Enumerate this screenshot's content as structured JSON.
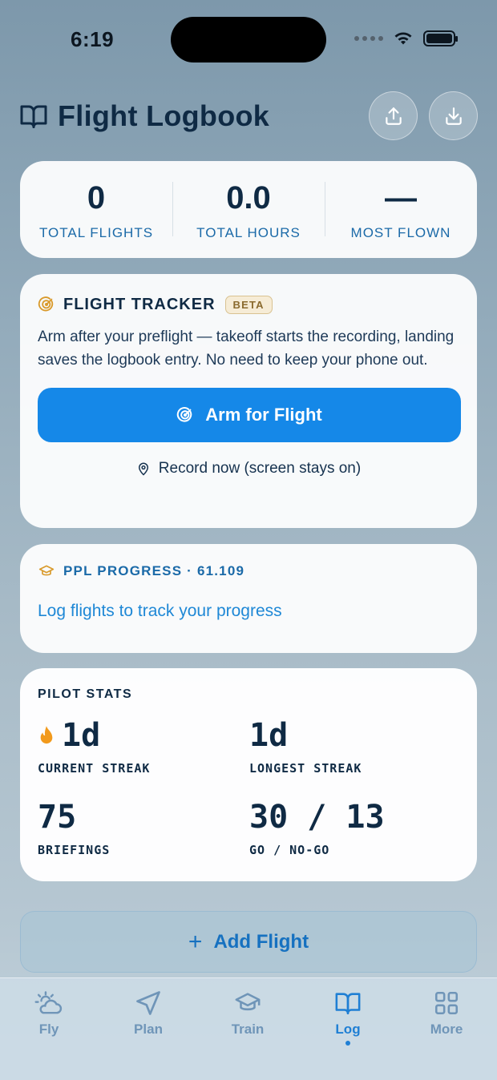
{
  "status_bar": {
    "time": "6:19"
  },
  "header": {
    "title": "Flight Logbook",
    "share_icon": "share-icon",
    "download_icon": "download-icon"
  },
  "summary": [
    {
      "value": "0",
      "label": "TOTAL FLIGHTS"
    },
    {
      "value": "0.0",
      "label": "TOTAL HOURS"
    },
    {
      "value": "—",
      "label": "MOST FLOWN"
    }
  ],
  "tracker": {
    "title": "FLIGHT TRACKER",
    "badge": "BETA",
    "description": "Arm after your preflight — takeoff starts the recording, landing saves the logbook entry. No need to keep your phone out.",
    "arm_label": "Arm for Flight",
    "record_label": "Record now (screen stays on)"
  },
  "ppl": {
    "title": "PPL PROGRESS · 61.109",
    "message": "Log flights to track your progress"
  },
  "stats": {
    "title": "PILOT STATS",
    "items": [
      {
        "value": "1d",
        "label": "CURRENT STREAK"
      },
      {
        "value": "1d",
        "label": "LONGEST STREAK"
      },
      {
        "value": "75",
        "label": "BRIEFINGS"
      },
      {
        "value": "30 / 13",
        "label": "GO / NO-GO"
      }
    ]
  },
  "add_flight": {
    "label": "Add Flight"
  },
  "tabs": [
    {
      "label": "Fly",
      "icon": "cloud-sun-icon"
    },
    {
      "label": "Plan",
      "icon": "navigation-icon"
    },
    {
      "label": "Train",
      "icon": "graduation-cap-icon"
    },
    {
      "label": "Log",
      "icon": "book-icon",
      "active": true
    },
    {
      "label": "More",
      "icon": "grid-icon"
    }
  ],
  "colors": {
    "accent": "#1588e8",
    "title": "#0f2a44",
    "link": "#1f88d6"
  }
}
